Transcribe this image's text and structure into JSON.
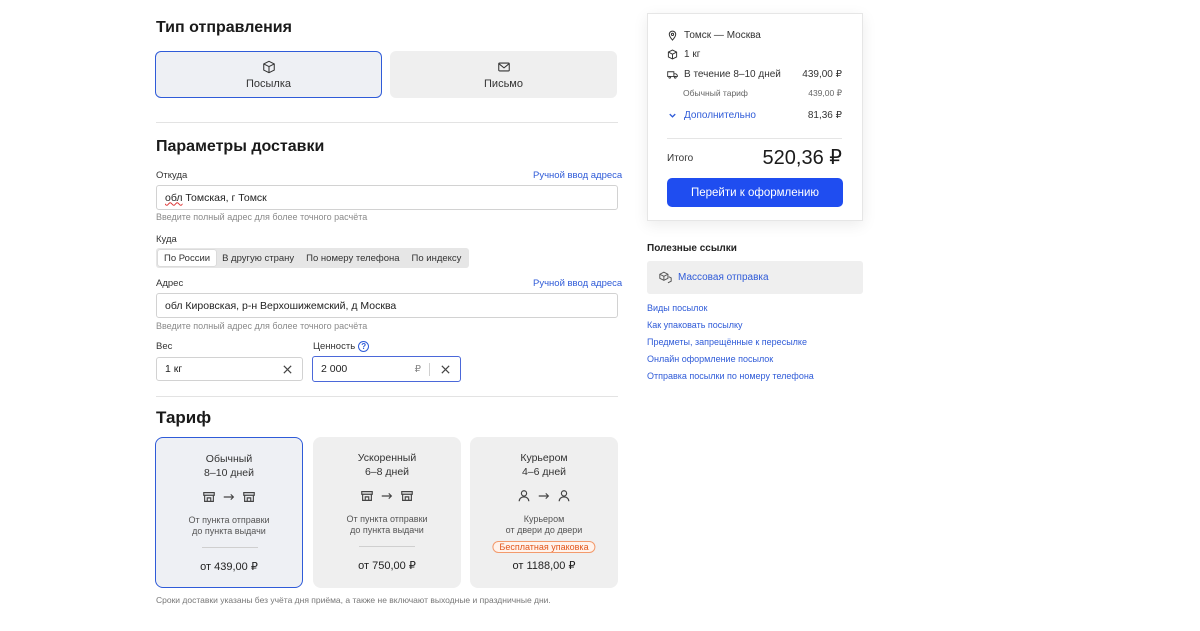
{
  "send_type": {
    "title": "Тип отправления",
    "options": [
      {
        "label": "Посылка",
        "icon": "box-icon"
      },
      {
        "label": "Письмо",
        "icon": "envelope-icon"
      }
    ]
  },
  "delivery": {
    "title": "Параметры доставки",
    "from_label": "Откуда",
    "manual_address_link": "Ручной ввод адреса",
    "from_value_prefix": "обл",
    "from_value_rest": " Томская, г Томск",
    "hint": "Введите полный адрес для более точного расчёта",
    "to_label": "Куда",
    "to_tabs": [
      "По России",
      "В другую страну",
      "По номеру телефона",
      "По индексу"
    ],
    "address_label": "Адрес",
    "address_value": "обл Кировская, р-н Верхошижемский, д Москва",
    "weight_label": "Вес",
    "weight_value": "1 кг",
    "value_label": "Ценность",
    "value_value": "2 000",
    "currency": "₽"
  },
  "tariff": {
    "title": "Тариф",
    "cards": [
      {
        "name": "Обычный",
        "days": "8–10 дней",
        "desc1": "От пункта отправки",
        "desc2": "до пункта выдачи",
        "price": "от 439,00 ₽",
        "badge": ""
      },
      {
        "name": "Ускоренный",
        "days": "6–8 дней",
        "desc1": "От пункта отправки",
        "desc2": "до пункта выдачи",
        "price": "от 750,00 ₽",
        "badge": ""
      },
      {
        "name": "Курьером",
        "days": "4–6 дней",
        "desc1": "Курьером",
        "desc2": "от двери до двери",
        "price": "от 1188,00 ₽",
        "badge": "Бесплатная упаковка"
      }
    ],
    "note": "Сроки доставки указаны без учёта дня приёма, а также не включают выходные и праздничные дни."
  },
  "summary": {
    "route": "Томск — Москва",
    "weight": "1 кг",
    "term": "В течение 8–10 дней",
    "term_price": "439,00 ₽",
    "tariff_name": "Обычный тариф",
    "tariff_price": "439,00 ₽",
    "extra_label": "Дополнительно",
    "extra_price": "81,36 ₽",
    "total_label": "Итого",
    "total_value": "520,36 ₽",
    "checkout_button": "Перейти к оформлению"
  },
  "useful": {
    "title": "Полезные ссылки",
    "mass_send": "Массовая отправка",
    "links": [
      "Виды посылок",
      "Как упаковать посылку",
      "Предметы, запрещённые к пересылке",
      "Онлайн оформление посылок",
      "Отправка посылки по номеру телефона"
    ]
  },
  "colors": {
    "accent": "#2f5bd8",
    "button": "#1f4df0",
    "badge": "#e2571c"
  }
}
